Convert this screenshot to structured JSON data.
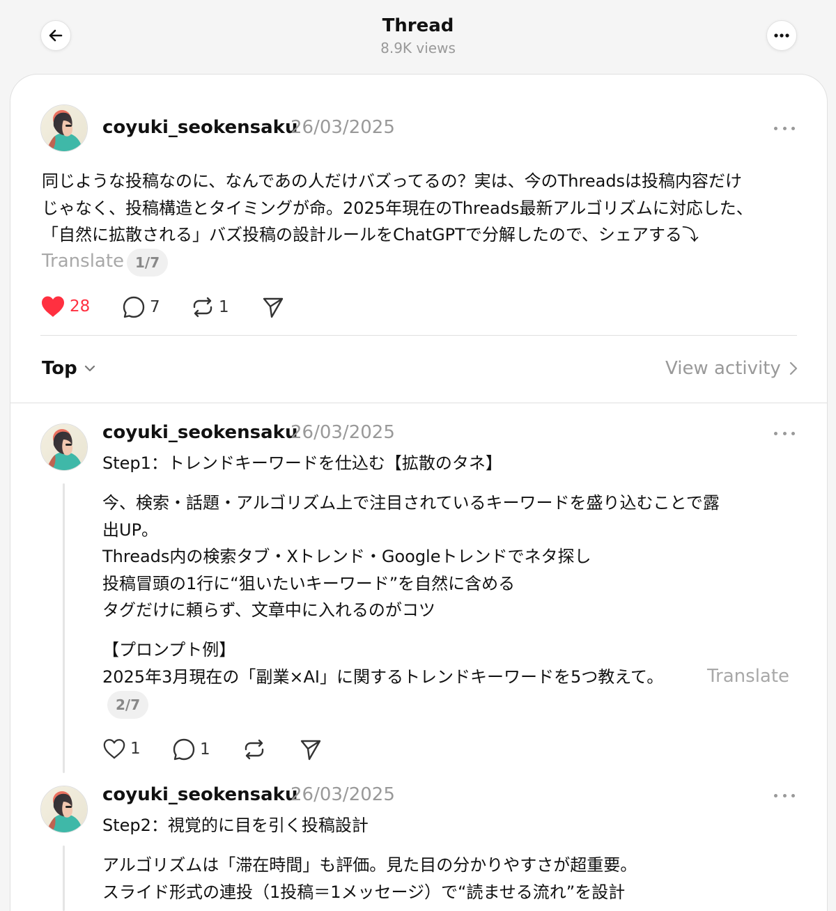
{
  "header": {
    "title": "Thread",
    "views": "8.9K views"
  },
  "main_post": {
    "username": "coyuki_seokensaku",
    "date": "26/03/2025",
    "lines": [
      "同じような投稿なのに、なんであの人だけバズってるの？実は、今のThreadsは投稿内容だけ",
      "じゃなく、投稿構造とタイミングが命。2025年現在のThreads最新アルゴリズムに対応した、",
      "「自然に拡散される」バズ投稿の設計ルールをChatGPTで分解したので、シェアする⤵︎"
    ],
    "translate_label": "Translate",
    "page_indicator": "1/7",
    "likes": "28",
    "comments": "7",
    "reposts": "1",
    "like_color": "#ff3040"
  },
  "sort": {
    "label": "Top",
    "view_activity": "View activity"
  },
  "replies": [
    {
      "username": "coyuki_seokensaku",
      "date": "26/03/2025",
      "heading": "Step1：トレンドキーワードを仕込む【拡散のタネ】",
      "body": [
        "今、検索・話題・アルゴリズム上で注目されているキーワードを盛り込むことで露",
        "出UP。",
        "Threads内の検索タブ・Xトレンド・Googleトレンドでネタ探し",
        "投稿冒頭の1行に“狙いたいキーワード”を自然に含める",
        "タグだけに頼らず、文章中に入れるのがコツ"
      ],
      "prompt_title": "【プロンプト例】",
      "prompt_text": "2025年3月現在の「副業×AI」に関するトレンドキーワードを5つ教えて。",
      "translate_label": "Translate",
      "page_indicator": "2/7",
      "likes": "1",
      "comments": "1"
    },
    {
      "username": "coyuki_seokensaku",
      "date": "26/03/2025",
      "heading": "Step2：視覚的に目を引く投稿設計",
      "body": [
        "アルゴリズムは「滞在時間」も評価。見た目の分かりやすさが超重要。",
        "スライド形式の連投（1投稿＝1メッセージ）で“読ませる流れ”を設計"
      ]
    }
  ],
  "colors": {
    "background": "#f5f5f5",
    "card": "#ffffff",
    "muted_text": "#999999"
  }
}
